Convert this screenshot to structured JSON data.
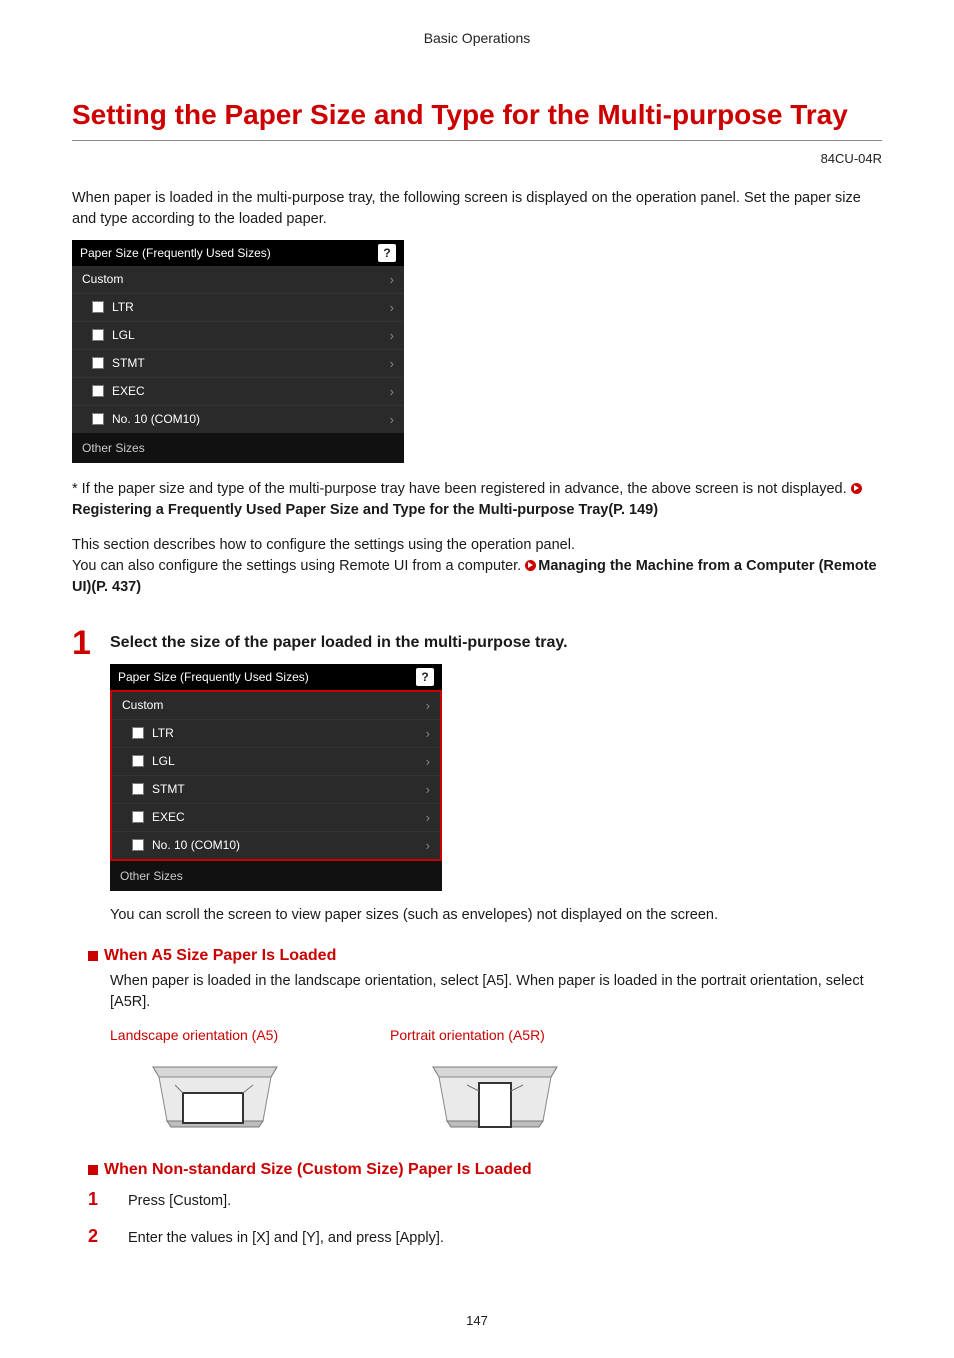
{
  "header": {
    "breadcrumb": "Basic Operations"
  },
  "title": "Setting the Paper Size and Type for the Multi-purpose Tray",
  "doc_code": "84CU-04R",
  "intro": "When paper is loaded in the multi-purpose tray, the following screen is displayed on the operation panel. Set the paper size and type according to the loaded paper.",
  "panel": {
    "header": "Paper Size (Frequently Used Sizes)",
    "help": "?",
    "rows": [
      {
        "label": "Custom",
        "indent": false,
        "icon": false
      },
      {
        "label": "LTR",
        "indent": true,
        "icon": true
      },
      {
        "label": "LGL",
        "indent": true,
        "icon": true
      },
      {
        "label": "STMT",
        "indent": true,
        "icon": true
      },
      {
        "label": "EXEC",
        "indent": true,
        "icon": true
      },
      {
        "label": "No. 10 (COM10)",
        "indent": true,
        "icon": true
      }
    ],
    "footer": "Other Sizes"
  },
  "note1_prefix": "* If the paper size and type of the multi-purpose tray have been registered in advance, the above screen is not displayed. ",
  "link1": "Registering a Frequently Used Paper Size and Type for the Multi-purpose Tray(P. 149)",
  "note2_line1": "This section describes how to configure the settings using the operation panel.",
  "note2_line2_prefix": "You can also configure the settings using Remote UI from a computer. ",
  "link2": "Managing the Machine from a Computer (Remote UI)(P. 437)",
  "step1": {
    "num": "1",
    "title": "Select the size of the paper loaded in the multi-purpose tray.",
    "subnote": "You can scroll the screen to view paper sizes (such as envelopes) not displayed on the screen."
  },
  "subsection_a5": {
    "heading": "When A5 Size Paper Is Loaded",
    "body": "When paper is loaded in the landscape orientation, select [A5]. When paper is loaded in the portrait orientation, select [A5R].",
    "caption_landscape": "Landscape orientation (A5)",
    "caption_portrait": "Portrait orientation (A5R)"
  },
  "subsection_custom": {
    "heading": "When Non-standard Size (Custom Size) Paper Is Loaded",
    "steps": [
      {
        "num": "1",
        "text": "Press [Custom]."
      },
      {
        "num": "2",
        "text": "Enter the values in [X] and [Y], and press [Apply]."
      }
    ]
  },
  "page_number": "147"
}
